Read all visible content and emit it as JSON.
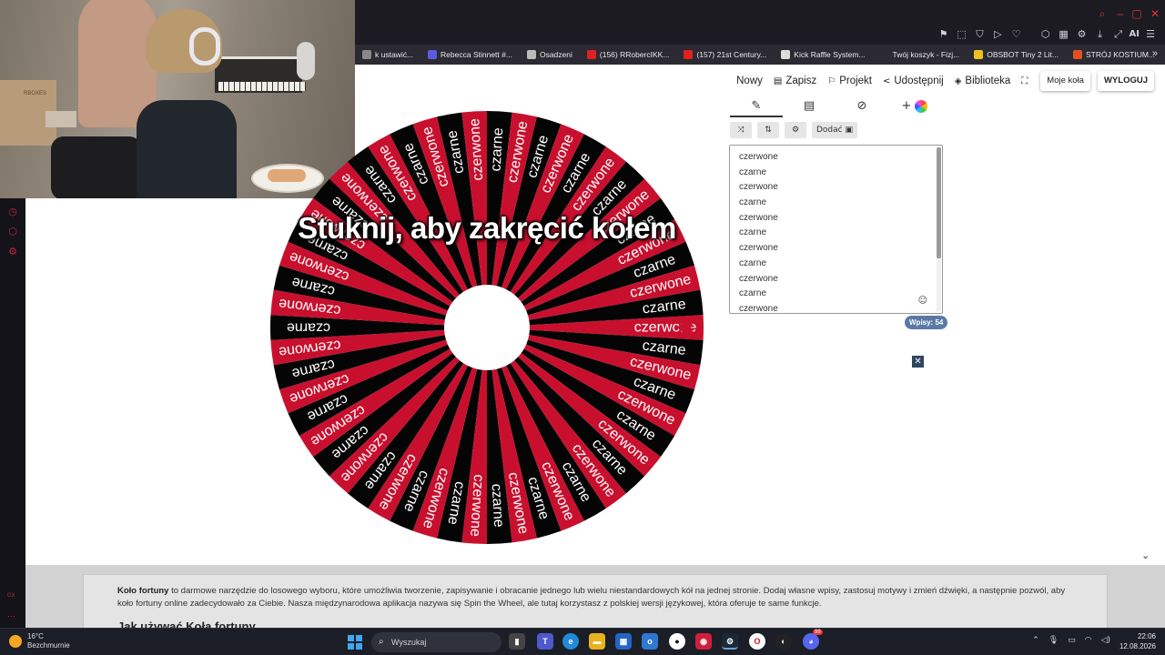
{
  "browser": {
    "bookmarks": [
      {
        "label": "k ustawić...",
        "color": "#888888"
      },
      {
        "label": "Rebecca Stinnett #...",
        "color": "#5a5ae0"
      },
      {
        "label": "Osadzeni",
        "color": "#bbbbbb"
      },
      {
        "label": "(156) RRobercIKK...",
        "color": "#e02020"
      },
      {
        "label": "(157) 21st Century...",
        "color": "#e02020"
      },
      {
        "label": "Kick Raffle System...",
        "color": "#dddddd"
      },
      {
        "label": "Twój koszyk - Fizj...",
        "color": "#2b2a33"
      },
      {
        "label": "OBSBOT Tiny 2 Lit...",
        "color": "#f0c020"
      },
      {
        "label": "STRÓJ KOSTIUM...",
        "color": "#e05020"
      }
    ],
    "ai_label": "AI"
  },
  "nav": {
    "new_label": "Nowy",
    "save_label": "Zapisz",
    "project_label": "Projekt",
    "share_label": "Udostępnij",
    "library_label": "Biblioteka",
    "my_wheels_label": "Moje koła",
    "logout_label": "WYLOGUJ"
  },
  "editor": {
    "add_label": "Dodać",
    "plus_label": "+",
    "entries": [
      "czerwone",
      "czarne",
      "czerwone",
      "czarne",
      "czerwone",
      "czarne",
      "czerwone",
      "czarne",
      "czerwone",
      "czarne",
      "czerwone"
    ],
    "count_label": "Wpisy: 54"
  },
  "wheel": {
    "title": "Stuknij, aby zakręcić kołem",
    "segment_count": 54,
    "labels": [
      "czerwone",
      "czarne"
    ],
    "colors": {
      "red": "#c8102e",
      "black": "#050505",
      "text": "#ffffff",
      "pointer": "#c8102e"
    }
  },
  "article": {
    "brand": "Koło fortuny",
    "intro": " to darmowe narzędzie do losowego wyboru, które umożliwia tworzenie, zapisywanie i obracanie jednego lub wielu niestandardowych kół na jednej stronie. Dodaj własne wpisy, zastosuj motywy i zmień dźwięki, a następnie pozwól, aby koło fortuny online zadecydowało za Ciebie. Nasza międzynarodowa aplikacja nazywa się Spin the Wheel, ale tutaj korzystasz z polskiej wersji językowej, która oferuje te same funkcje.",
    "heading": "Jak używać Koła fortuny"
  },
  "webcam": {
    "box_label": "RBOXES"
  },
  "leftbar": {
    "footer_label": "GX"
  },
  "taskbar": {
    "weather_temp": "16°C",
    "weather_desc": "Bezchmurnie",
    "search_placeholder": "Wyszukaj",
    "time": "22:06",
    "date": "12.08.2026",
    "badge_count": "99"
  }
}
